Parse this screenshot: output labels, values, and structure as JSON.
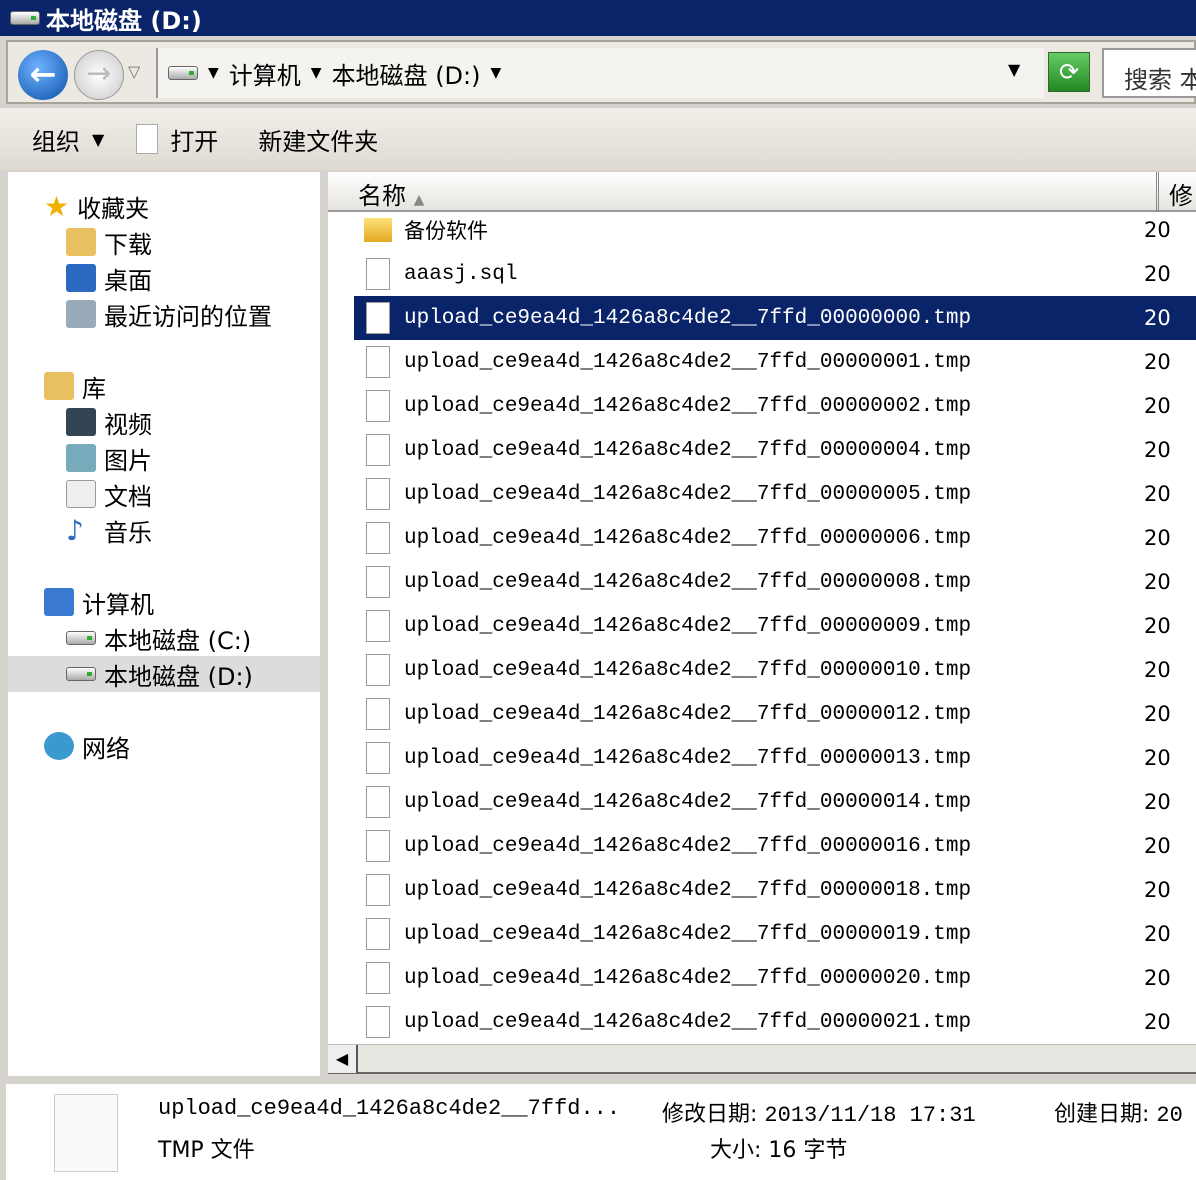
{
  "window": {
    "title": "本地磁盘 (D:)"
  },
  "address": {
    "crumbs": [
      "计算机",
      "本地磁盘 (D:)"
    ],
    "search_placeholder": "搜索 本"
  },
  "toolbar": {
    "organize": "组织",
    "open": "打开",
    "new_folder": "新建文件夹"
  },
  "nav": {
    "favorites": "收藏夹",
    "downloads": "下载",
    "desktop": "桌面",
    "recent": "最近访问的位置",
    "libraries": "库",
    "videos": "视频",
    "pictures": "图片",
    "documents": "文档",
    "music": "音乐",
    "computer": "计算机",
    "drive_c": "本地磁盘 (C:)",
    "drive_d": "本地磁盘 (D:)",
    "network": "网络"
  },
  "list": {
    "col_name": "名称",
    "col_modified": "修",
    "items": [
      {
        "name": "备份软件",
        "type": "folder",
        "date": "20"
      },
      {
        "name": "aaasj.sql",
        "type": "file",
        "date": "20"
      },
      {
        "name": "upload_ce9ea4d_1426a8c4de2__7ffd_00000000.tmp",
        "type": "file",
        "date": "20",
        "selected": true
      },
      {
        "name": "upload_ce9ea4d_1426a8c4de2__7ffd_00000001.tmp",
        "type": "file",
        "date": "20"
      },
      {
        "name": "upload_ce9ea4d_1426a8c4de2__7ffd_00000002.tmp",
        "type": "file",
        "date": "20"
      },
      {
        "name": "upload_ce9ea4d_1426a8c4de2__7ffd_00000004.tmp",
        "type": "file",
        "date": "20"
      },
      {
        "name": "upload_ce9ea4d_1426a8c4de2__7ffd_00000005.tmp",
        "type": "file",
        "date": "20"
      },
      {
        "name": "upload_ce9ea4d_1426a8c4de2__7ffd_00000006.tmp",
        "type": "file",
        "date": "20"
      },
      {
        "name": "upload_ce9ea4d_1426a8c4de2__7ffd_00000008.tmp",
        "type": "file",
        "date": "20"
      },
      {
        "name": "upload_ce9ea4d_1426a8c4de2__7ffd_00000009.tmp",
        "type": "file",
        "date": "20"
      },
      {
        "name": "upload_ce9ea4d_1426a8c4de2__7ffd_00000010.tmp",
        "type": "file",
        "date": "20"
      },
      {
        "name": "upload_ce9ea4d_1426a8c4de2__7ffd_00000012.tmp",
        "type": "file",
        "date": "20"
      },
      {
        "name": "upload_ce9ea4d_1426a8c4de2__7ffd_00000013.tmp",
        "type": "file",
        "date": "20"
      },
      {
        "name": "upload_ce9ea4d_1426a8c4de2__7ffd_00000014.tmp",
        "type": "file",
        "date": "20"
      },
      {
        "name": "upload_ce9ea4d_1426a8c4de2__7ffd_00000016.tmp",
        "type": "file",
        "date": "20"
      },
      {
        "name": "upload_ce9ea4d_1426a8c4de2__7ffd_00000018.tmp",
        "type": "file",
        "date": "20"
      },
      {
        "name": "upload_ce9ea4d_1426a8c4de2__7ffd_00000019.tmp",
        "type": "file",
        "date": "20"
      },
      {
        "name": "upload_ce9ea4d_1426a8c4de2__7ffd_00000020.tmp",
        "type": "file",
        "date": "20"
      },
      {
        "name": "upload_ce9ea4d_1426a8c4de2__7ffd_00000021.tmp",
        "type": "file",
        "date": "20"
      }
    ]
  },
  "details": {
    "name": "upload_ce9ea4d_1426a8c4de2__7ffd...",
    "type": "TMP 文件",
    "modified_label": "修改日期:",
    "modified": "2013/11/18 17:31",
    "created_label": "创建日期:",
    "created": "20",
    "size_label": "大小:",
    "size": "16 字节"
  }
}
